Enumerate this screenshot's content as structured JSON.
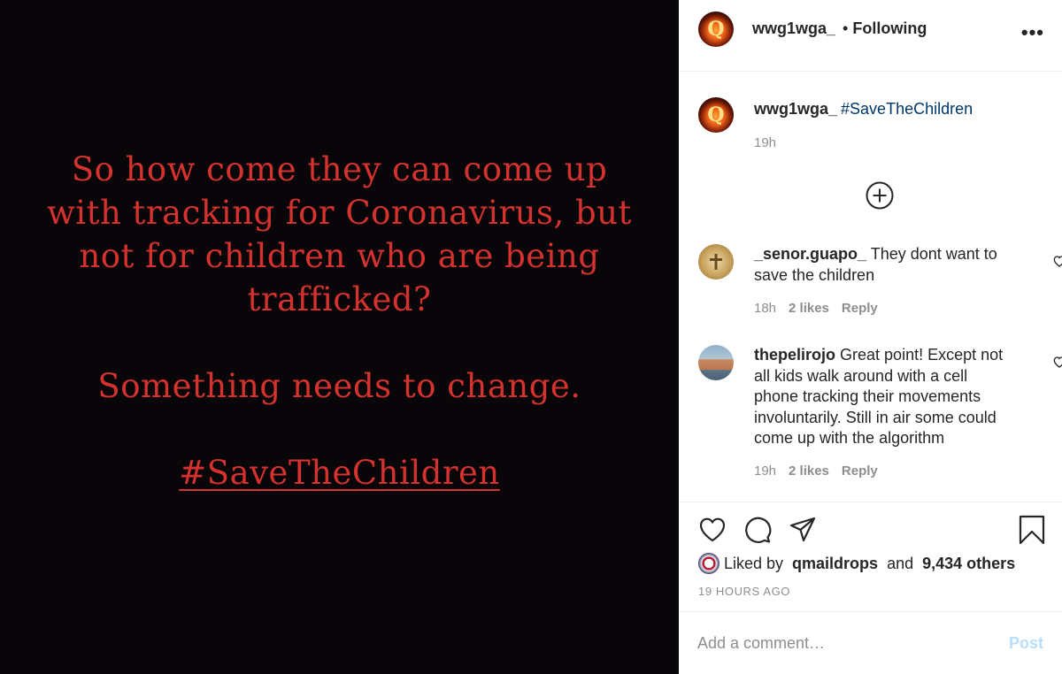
{
  "image": {
    "line1": "So how come they can come up with tracking for Coronavirus, but not for children who are being trafficked?",
    "line2": "Something needs to change.",
    "line3": "#SaveTheChildren",
    "text_color": "#d5322f",
    "background_color": "#080608"
  },
  "header": {
    "username": "wwg1wga_",
    "separator": "•",
    "follow_status": "Following",
    "more_label": "•••"
  },
  "caption": {
    "username": "wwg1wga_",
    "hashtag": "#SaveTheChildren",
    "time": "19h"
  },
  "comments": [
    {
      "username": "_senor.guapo_",
      "text": "They dont want to save the children",
      "time": "18h",
      "likes": "2 likes",
      "reply": "Reply"
    },
    {
      "username": "thepelirojo",
      "text": "Great point! Except not all kids walk around with a cell phone tracking their movements involuntarily. Still in air some could come up with the algorithm",
      "time": "19h",
      "likes": "2 likes",
      "reply": "Reply"
    }
  ],
  "likes": {
    "prefix": "Liked by",
    "user": "qmaildrops",
    "conjunction": "and",
    "count": "9,434 others"
  },
  "post_age": "19 HOURS AGO",
  "comment_box": {
    "placeholder": "Add a comment…",
    "post_label": "Post"
  },
  "colors": {
    "hashtag_link": "#00376b",
    "muted_text": "#8e8e8e",
    "post_button_disabled": "#b9dffc"
  },
  "icons": [
    "more-icon",
    "add-circle-icon",
    "heart-icon",
    "comment-icon",
    "share-icon",
    "bookmark-icon"
  ]
}
